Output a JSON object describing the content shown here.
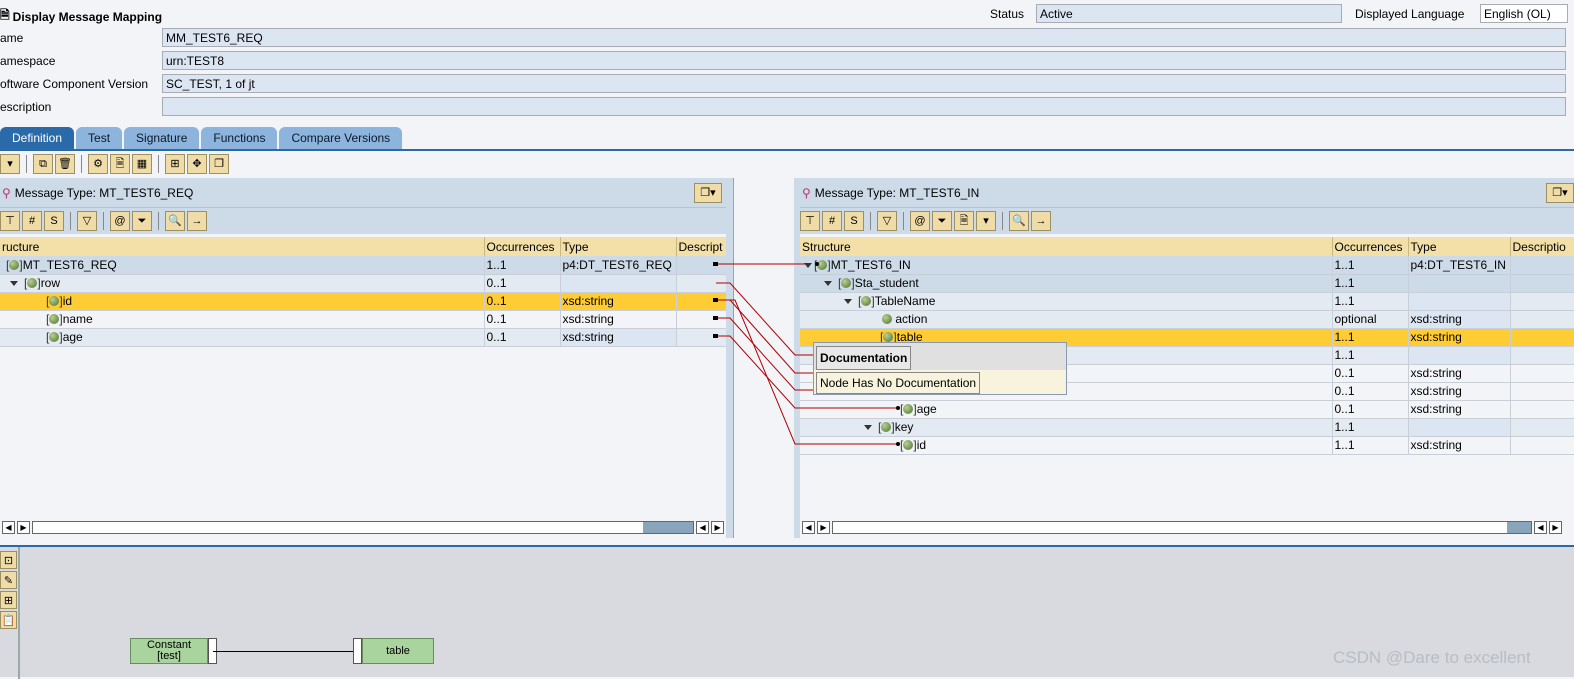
{
  "header": {
    "title": "Display Message Mapping",
    "status_label": "Status",
    "status_value": "Active",
    "lang_label": "Displayed Language",
    "lang_value": "English (OL)"
  },
  "fields": [
    {
      "label": "ame",
      "value": "MM_TEST6_REQ"
    },
    {
      "label": "amespace",
      "value": "urn:TEST8"
    },
    {
      "label": "oftware Component Version",
      "value": "SC_TEST, 1 of jt"
    },
    {
      "label": "escription",
      "value": ""
    }
  ],
  "tabs": [
    "Definition",
    "Test",
    "Signature",
    "Functions",
    "Compare Versions"
  ],
  "source": {
    "title": "Message Type: MT_TEST6_REQ",
    "columns": [
      "ructure",
      "Occurrences",
      "Type",
      "Descript"
    ],
    "rows": [
      {
        "name": "MT_TEST6_REQ",
        "occ": "1..1",
        "type": "p4:DT_TEST6_REQ"
      },
      {
        "name": "row",
        "occ": "0..1",
        "type": ""
      },
      {
        "name": "id",
        "occ": "0..1",
        "type": "xsd:string"
      },
      {
        "name": "name",
        "occ": "0..1",
        "type": "xsd:string"
      },
      {
        "name": "age",
        "occ": "0..1",
        "type": "xsd:string"
      }
    ]
  },
  "target": {
    "title": "Message Type: MT_TEST6_IN",
    "columns": [
      "Structure",
      "Occurrences",
      "Type",
      "Descriptio"
    ],
    "rows": [
      {
        "name": "MT_TEST6_IN",
        "occ": "1..1",
        "type": "p4:DT_TEST6_IN"
      },
      {
        "name": "Sta_student",
        "occ": "1..1",
        "type": ""
      },
      {
        "name": "TableName",
        "occ": "1..1",
        "type": ""
      },
      {
        "name": "action",
        "occ": "optional",
        "type": "xsd:string"
      },
      {
        "name": "table",
        "occ": "1..1",
        "type": "xsd:string"
      },
      {
        "name": "",
        "occ": "1..1",
        "type": ""
      },
      {
        "name": "",
        "occ": "0..1",
        "type": "xsd:string"
      },
      {
        "name": "",
        "occ": "0..1",
        "type": "xsd:string"
      },
      {
        "name": "age",
        "occ": "0..1",
        "type": "xsd:string"
      },
      {
        "name": "key",
        "occ": "1..1",
        "type": ""
      },
      {
        "name": "id",
        "occ": "1..1",
        "type": "xsd:string"
      }
    ]
  },
  "doc_popup": {
    "title": "Documentation",
    "text": "Node Has No Documentation"
  },
  "mapping": {
    "constant_label": "Constant",
    "constant_value": "[test]",
    "target_label": "table"
  },
  "watermark": "CSDN @Dare to excellent",
  "colors": {
    "accent": "#2b6aa8",
    "selected": "#ffcc33",
    "link": "#b00000"
  }
}
